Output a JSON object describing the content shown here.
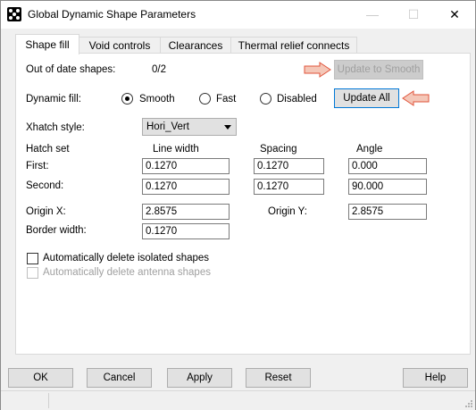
{
  "window": {
    "title": "Global Dynamic Shape Parameters",
    "minimize_glyph": "—",
    "maximize_glyph": "☐",
    "close_glyph": "✕"
  },
  "tabs": [
    {
      "label": "Shape fill",
      "active": true
    },
    {
      "label": "Void controls",
      "active": false
    },
    {
      "label": "Clearances",
      "active": false
    },
    {
      "label": "Thermal relief connects",
      "active": false
    }
  ],
  "shape_fill": {
    "out_of_date_label": "Out of date shapes:",
    "out_of_date_value": "0/2",
    "update_smooth_label": "Update to Smooth",
    "dynamic_fill_label": "Dynamic fill:",
    "fill_options": [
      "Smooth",
      "Fast",
      "Disabled"
    ],
    "fill_selected": "Smooth",
    "update_all_label": "Update All",
    "xhatch_label": "Xhatch style:",
    "xhatch_value": "Hori_Vert",
    "hatch_set_label": "Hatch set",
    "col_line_width": "Line width",
    "col_spacing": "Spacing",
    "col_angle": "Angle",
    "first_label": "First:",
    "first": {
      "line_width": "0.1270",
      "spacing": "0.1270",
      "angle": "0.000"
    },
    "second_label": "Second:",
    "second": {
      "line_width": "0.1270",
      "spacing": "0.1270",
      "angle": "90.000"
    },
    "origin_x_label": "Origin X:",
    "origin_x": "2.8575",
    "origin_y_label": "Origin Y:",
    "origin_y": "2.8575",
    "border_width_label": "Border width:",
    "border_width": "0.1270",
    "auto_delete_isolated_label": "Automatically delete isolated shapes",
    "auto_delete_isolated_checked": false,
    "auto_delete_antenna_label": "Automatically delete antenna shapes",
    "auto_delete_antenna_checked": false
  },
  "footer": {
    "ok": "OK",
    "cancel": "Cancel",
    "apply": "Apply",
    "reset": "Reset",
    "help": "Help"
  },
  "colors": {
    "callout_arrow_fill": "#f4c7b8",
    "callout_arrow_stroke": "#e0533a"
  }
}
